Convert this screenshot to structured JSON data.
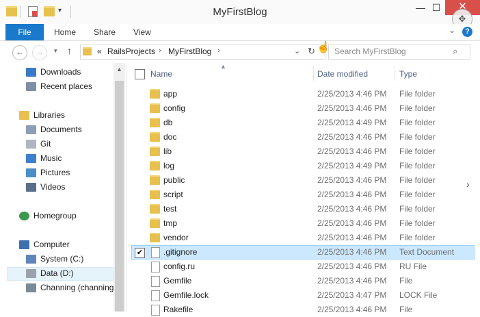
{
  "window": {
    "title": "MyFirstBlog",
    "minimize": "—",
    "maximize": "☐",
    "close": "✕"
  },
  "ribbon": {
    "tabs": [
      "File",
      "Home",
      "Share",
      "View"
    ],
    "help": "?"
  },
  "nav": {
    "path": [
      "«",
      "RailsProjects",
      "MyFirstBlog"
    ],
    "search_placeholder": "Search MyFirstBlog"
  },
  "navpane": {
    "items": [
      {
        "label": "Downloads",
        "icon": "downloads-folder-icon",
        "color": "#3a7ac9"
      },
      {
        "label": "Recent places",
        "icon": "recent-places-icon",
        "color": "#7f8ea3"
      },
      {
        "label": "Libraries",
        "icon": "libraries-icon",
        "color": "#e8c04d"
      },
      {
        "label": "Documents",
        "icon": "documents-icon",
        "color": "#8c9db5"
      },
      {
        "label": "Git",
        "icon": "git-icon",
        "color": "#b0b6bf"
      },
      {
        "label": "Music",
        "icon": "music-icon",
        "color": "#3f7fcc"
      },
      {
        "label": "Pictures",
        "icon": "pictures-icon",
        "color": "#4a8ec8"
      },
      {
        "label": "Videos",
        "icon": "videos-icon",
        "color": "#5a6f8a"
      },
      {
        "label": "Homegroup",
        "icon": "homegroup-icon",
        "color": "#3b9a4c"
      },
      {
        "label": "Computer",
        "icon": "computer-icon",
        "color": "#3f6fb0"
      },
      {
        "label": "System (C:)",
        "icon": "drive-c-icon",
        "color": "#5f86b8"
      },
      {
        "label": "Data (D:)",
        "icon": "drive-d-icon",
        "color": "#9aa3ad"
      },
      {
        "label": "Channing (channing",
        "icon": "network-drive-icon",
        "color": "#7c8a98"
      }
    ]
  },
  "columns": {
    "name": "Name",
    "date": "Date modified",
    "type": "Type"
  },
  "files": [
    {
      "name": "app",
      "date": "2/25/2013 4:46 PM",
      "type": "File folder",
      "kind": "folder"
    },
    {
      "name": "config",
      "date": "2/25/2013 4:46 PM",
      "type": "File folder",
      "kind": "folder"
    },
    {
      "name": "db",
      "date": "2/25/2013 4:49 PM",
      "type": "File folder",
      "kind": "folder"
    },
    {
      "name": "doc",
      "date": "2/25/2013 4:46 PM",
      "type": "File folder",
      "kind": "folder"
    },
    {
      "name": "lib",
      "date": "2/25/2013 4:46 PM",
      "type": "File folder",
      "kind": "folder"
    },
    {
      "name": "log",
      "date": "2/25/2013 4:49 PM",
      "type": "File folder",
      "kind": "folder"
    },
    {
      "name": "public",
      "date": "2/25/2013 4:46 PM",
      "type": "File folder",
      "kind": "folder"
    },
    {
      "name": "script",
      "date": "2/25/2013 4:46 PM",
      "type": "File folder",
      "kind": "folder"
    },
    {
      "name": "test",
      "date": "2/25/2013 4:46 PM",
      "type": "File folder",
      "kind": "folder"
    },
    {
      "name": "tmp",
      "date": "2/25/2013 4:46 PM",
      "type": "File folder",
      "kind": "folder"
    },
    {
      "name": "vendor",
      "date": "2/25/2013 4:46 PM",
      "type": "File folder",
      "kind": "folder"
    },
    {
      "name": ".gitignore",
      "date": "2/25/2013 4:46 PM",
      "type": "Text Document",
      "kind": "file",
      "selected": true
    },
    {
      "name": "config.ru",
      "date": "2/25/2013 4:46 PM",
      "type": "RU File",
      "kind": "file"
    },
    {
      "name": "Gemfile",
      "date": "2/25/2013 4:46 PM",
      "type": "File",
      "kind": "file"
    },
    {
      "name": "Gemfile.lock",
      "date": "2/25/2013 4:47 PM",
      "type": "LOCK File",
      "kind": "file"
    },
    {
      "name": "Rakefile",
      "date": "2/25/2013 4:46 PM",
      "type": "File",
      "kind": "file"
    }
  ]
}
